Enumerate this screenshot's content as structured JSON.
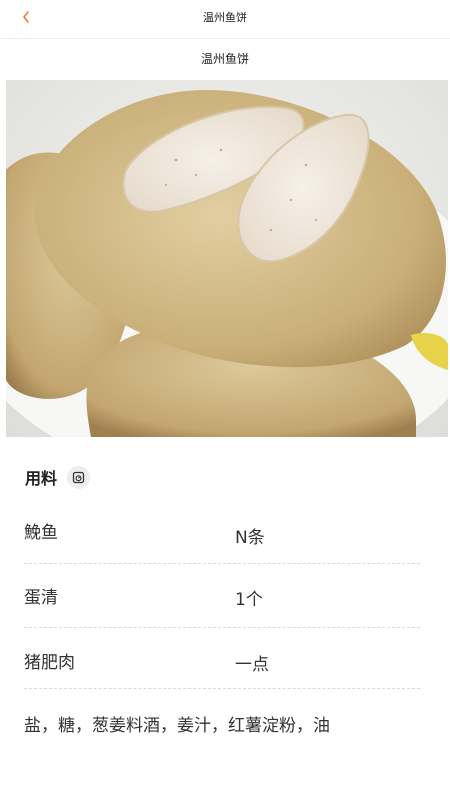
{
  "nav": {
    "title": "温州鱼饼"
  },
  "recipe": {
    "title": "温州鱼饼"
  },
  "ingredients": {
    "heading": "用料",
    "items": [
      {
        "name": "鮸鱼",
        "amount": "N条"
      },
      {
        "name": "蛋清",
        "amount": "1个"
      },
      {
        "name": "猪肥肉",
        "amount": "一点"
      }
    ],
    "seasonings": "盐，糖，葱姜料酒，姜汁，红薯淀粉，油"
  },
  "colors": {
    "accent": "#f07a3a",
    "divider": "#d9d9d9"
  },
  "icons": {
    "back": "chevron-left-icon",
    "scale": "kitchen-scale-icon"
  }
}
